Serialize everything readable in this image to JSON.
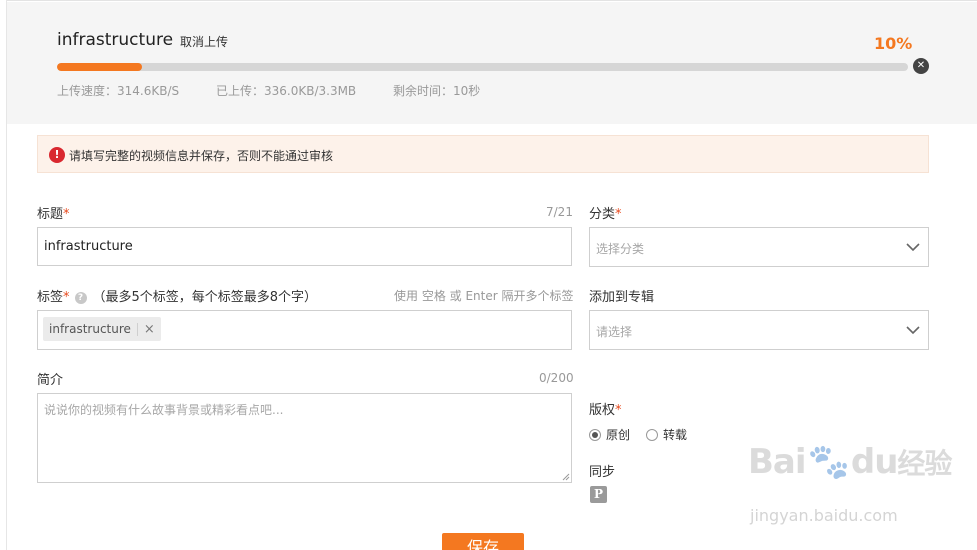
{
  "upload": {
    "file_name": "infrastructure",
    "cancel_label": "取消上传",
    "percent_text": "10%",
    "progress": 0.1,
    "speed": "上传速度：314.6KB/S",
    "uploaded": "已上传：336.0KB/3.3MB",
    "remaining": "剩余时间：10秒"
  },
  "warning": {
    "text": "请填写完整的视频信息并保存，否则不能通过审核"
  },
  "title_field": {
    "label": "标题",
    "required_mark": "*",
    "counter": "7/21",
    "value": "infrastructure"
  },
  "category": {
    "label": "分类",
    "required_mark": "*",
    "placeholder": "选择分类"
  },
  "tags": {
    "label": "标签",
    "required_mark": "*",
    "note": "（最多5个标签，每个标签最多8个字）",
    "hint": "使用 空格 或 Enter 隔开多个标签",
    "items": [
      "infrastructure"
    ],
    "remove_symbol": "×"
  },
  "album": {
    "label": "添加到专辑",
    "placeholder": "请选择"
  },
  "description": {
    "label": "简介",
    "counter": "0/200",
    "placeholder": "说说你的视频有什么故事背景或精彩看点吧..."
  },
  "copyright": {
    "label": "版权",
    "required_mark": "*",
    "options": [
      {
        "label": "原创",
        "selected": true
      },
      {
        "label": "转载",
        "selected": false
      }
    ]
  },
  "sync": {
    "label": "同步"
  },
  "save_label": "保存",
  "watermark": {
    "logo_text_1": "Bai",
    "logo_text_2": "du",
    "logo_text_3": "经验",
    "url": "jingyan.baidu.com"
  },
  "colors": {
    "accent": "#f47820",
    "warning_bg": "#fdf2ea",
    "error_red": "#d9282f"
  }
}
